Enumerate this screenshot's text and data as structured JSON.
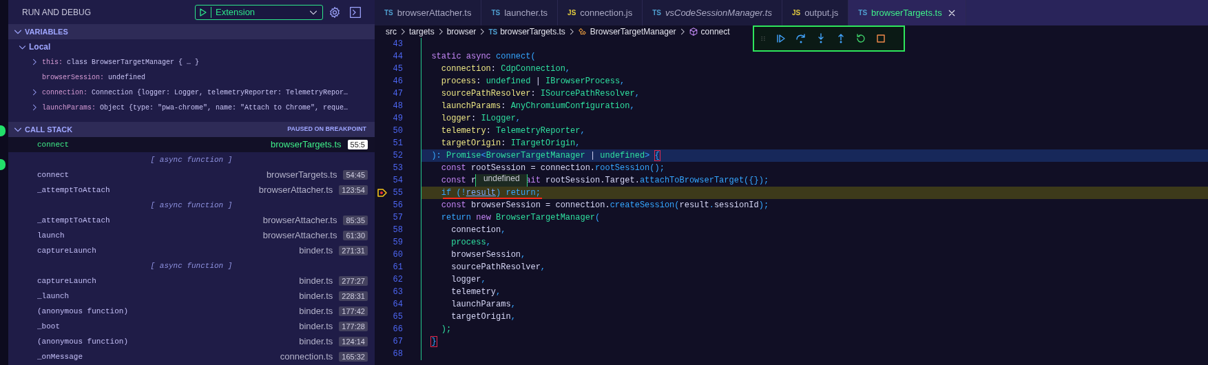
{
  "sidebar": {
    "title": "RUN AND DEBUG",
    "config": {
      "label": "Extension"
    },
    "variables": {
      "title": "VARIABLES",
      "expanded": true,
      "scopes": [
        {
          "label": "Local",
          "expanded": true,
          "children": [
            {
              "name": "this:",
              "value": "class BrowserTargetManager { … }",
              "expandable": true
            },
            {
              "name": "browserSession:",
              "value": "undefined",
              "expandable": false
            },
            {
              "name": "connection:",
              "value": "Connection {logger: Logger, telemetryReporter: TelemetryRepor…",
              "expandable": true
            },
            {
              "name": "launchParams:",
              "value": "Object {type: \"pwa-chrome\", name: \"Attach to Chrome\", reque…",
              "expandable": true
            }
          ]
        }
      ]
    },
    "call_stack": {
      "title": "CALL STACK",
      "status": "PAUSED ON BREAKPOINT",
      "expanded": true,
      "frames": [
        {
          "kind": "frame",
          "name": "connect",
          "file": "browserTargets.ts",
          "position": "55:5",
          "selected": true
        },
        {
          "kind": "async",
          "label": "[ async function ]"
        },
        {
          "kind": "frame",
          "name": "connect",
          "file": "browserTargets.ts",
          "position": "54:45",
          "selected": false
        },
        {
          "kind": "frame",
          "name": "_attemptToAttach",
          "file": "browserAttacher.ts",
          "position": "123:54",
          "selected": false
        },
        {
          "kind": "async",
          "label": "[ async function ]"
        },
        {
          "kind": "frame",
          "name": "_attemptToAttach",
          "file": "browserAttacher.ts",
          "position": "85:35",
          "selected": false
        },
        {
          "kind": "frame",
          "name": "launch",
          "file": "browserAttacher.ts",
          "position": "61:30",
          "selected": false
        },
        {
          "kind": "frame",
          "name": "captureLaunch",
          "file": "binder.ts",
          "position": "271:31",
          "selected": false
        },
        {
          "kind": "async",
          "label": "[ async function ]"
        },
        {
          "kind": "frame",
          "name": "captureLaunch",
          "file": "binder.ts",
          "position": "277:27",
          "selected": false
        },
        {
          "kind": "frame",
          "name": "_launch",
          "file": "binder.ts",
          "position": "228:31",
          "selected": false
        },
        {
          "kind": "frame",
          "name": "(anonymous function)",
          "file": "binder.ts",
          "position": "177:42",
          "selected": false
        },
        {
          "kind": "frame",
          "name": "_boot",
          "file": "binder.ts",
          "position": "177:28",
          "selected": false
        },
        {
          "kind": "frame",
          "name": "(anonymous function)",
          "file": "binder.ts",
          "position": "124:14",
          "selected": false
        },
        {
          "kind": "frame",
          "name": "_onMessage",
          "file": "connection.ts",
          "position": "165:32",
          "selected": false
        }
      ]
    }
  },
  "editor": {
    "tabs": [
      {
        "lang": "TS",
        "color": "#4f9fd0",
        "label": "browserAttacher.ts",
        "selected": false,
        "preview": false
      },
      {
        "lang": "TS",
        "color": "#4f9fd0",
        "label": "launcher.ts",
        "selected": false,
        "preview": false
      },
      {
        "lang": "JS",
        "color": "#e3cc3f",
        "label": "connection.js",
        "selected": false,
        "preview": false
      },
      {
        "lang": "TS",
        "color": "#4f9fd0",
        "label": "vsCodeSessionManager.ts",
        "selected": false,
        "preview": true
      },
      {
        "lang": "JS",
        "color": "#e3cc3f",
        "label": "output.js",
        "selected": false,
        "preview": false
      },
      {
        "lang": "TS",
        "color": "#4f9fd0",
        "label": "browserTargets.ts",
        "selected": true,
        "preview": false
      }
    ],
    "breadcrumbs": [
      {
        "kind": "folder",
        "label": "src"
      },
      {
        "kind": "folder",
        "label": "targets"
      },
      {
        "kind": "folder",
        "label": "browser"
      },
      {
        "kind": "file",
        "lang": "TS",
        "label": "browserTargets.ts"
      },
      {
        "kind": "class",
        "label": "BrowserTargetManager"
      },
      {
        "kind": "method",
        "label": "connect"
      }
    ],
    "lines": [
      {
        "n": "43"
      },
      {
        "n": "44",
        "tokens": [
          {
            "kind": "kw",
            "text": "  static async"
          },
          {
            "kind": "fn",
            "text": " connect("
          }
        ]
      },
      {
        "n": "45",
        "tokens": [
          {
            "kind": "param",
            "text": "    connection"
          },
          {
            "kind": "v",
            "text": ": "
          },
          {
            "kind": "type",
            "text": "CdpConnection"
          },
          {
            "kind": "p",
            "text": ","
          }
        ]
      },
      {
        "n": "46",
        "tokens": [
          {
            "kind": "param",
            "text": "    process"
          },
          {
            "kind": "v",
            "text": ": "
          },
          {
            "kind": "type",
            "text": "undefined"
          },
          {
            "kind": "v",
            "text": " | "
          },
          {
            "kind": "type",
            "text": "IBrowserProcess"
          },
          {
            "kind": "p",
            "text": ","
          }
        ]
      },
      {
        "n": "47",
        "tokens": [
          {
            "kind": "param",
            "text": "    sourcePathResolver"
          },
          {
            "kind": "v",
            "text": ": "
          },
          {
            "kind": "type",
            "text": "ISourcePathResolver"
          },
          {
            "kind": "p",
            "text": ","
          }
        ]
      },
      {
        "n": "48",
        "tokens": [
          {
            "kind": "param",
            "text": "    launchParams"
          },
          {
            "kind": "v",
            "text": ": "
          },
          {
            "kind": "type",
            "text": "AnyChromiumConfiguration"
          },
          {
            "kind": "p",
            "text": ","
          }
        ]
      },
      {
        "n": "49",
        "tokens": [
          {
            "kind": "param",
            "text": "    logger"
          },
          {
            "kind": "v",
            "text": ": "
          },
          {
            "kind": "type",
            "text": "ILogger"
          },
          {
            "kind": "p",
            "text": ","
          }
        ]
      },
      {
        "n": "50",
        "tokens": [
          {
            "kind": "param",
            "text": "    telemetry"
          },
          {
            "kind": "v",
            "text": ": "
          },
          {
            "kind": "type",
            "text": "TelemetryReporter"
          },
          {
            "kind": "p",
            "text": ","
          }
        ]
      },
      {
        "n": "51",
        "tokens": [
          {
            "kind": "param",
            "text": "    targetOrigin"
          },
          {
            "kind": "v",
            "text": ": "
          },
          {
            "kind": "type",
            "text": "ITargetOrigin"
          },
          {
            "kind": "p",
            "text": ","
          }
        ]
      },
      {
        "n": "52",
        "kind": "focus",
        "tokens": [
          {
            "kind": "p",
            "text": "  ): "
          },
          {
            "kind": "type",
            "text": "Promise"
          },
          {
            "kind": "p",
            "text": "<"
          },
          {
            "kind": "type",
            "text": "BrowserTargetManager"
          },
          {
            "kind": "v",
            "text": " | "
          },
          {
            "kind": "type",
            "text": "undefined"
          },
          {
            "kind": "p",
            "text": ">"
          },
          {
            "kind": "bm",
            "text": " {"
          }
        ]
      },
      {
        "n": "53",
        "tokens": [
          {
            "kind": "kw",
            "text": "    const"
          },
          {
            "kind": "v",
            "text": " rootSession = connection."
          },
          {
            "kind": "fn",
            "text": "rootSession"
          },
          {
            "kind": "p",
            "text": "();"
          }
        ]
      },
      {
        "n": "54",
        "tokens": [
          {
            "kind": "kw",
            "text": "    const"
          },
          {
            "kind": "v",
            "text": " r"
          },
          {
            "kind": "tooltip",
            "text": "undefined"
          },
          {
            "kind": "kw",
            "text": "ait"
          },
          {
            "kind": "v",
            "text": " rootSession.Target."
          },
          {
            "kind": "fn",
            "text": "attachToBrowserTarget"
          },
          {
            "kind": "p",
            "text": "({});"
          }
        ]
      },
      {
        "n": "55",
        "kind": "paused",
        "breakpoint": true,
        "squiggle": true,
        "tokens": [
          {
            "kind": "ctl",
            "text": "    if"
          },
          {
            "kind": "p",
            "text": " (!"
          },
          {
            "kind": "link",
            "text": "result"
          },
          {
            "kind": "p",
            "text": ")"
          },
          {
            "kind": "ctl",
            "text": " return"
          },
          {
            "kind": "p",
            "text": ";"
          }
        ]
      },
      {
        "n": "56",
        "tokens": [
          {
            "kind": "kw",
            "text": "    const"
          },
          {
            "kind": "v",
            "text": " browserSession = connection."
          },
          {
            "kind": "fn",
            "text": "createSession"
          },
          {
            "kind": "p",
            "text": "("
          },
          {
            "kind": "v",
            "text": "result"
          },
          {
            "kind": "p",
            "text": "."
          },
          {
            "kind": "v",
            "text": "sessionId"
          },
          {
            "kind": "p",
            "text": ");"
          }
        ]
      },
      {
        "n": "57",
        "tokens": [
          {
            "kind": "ctl",
            "text": "    return"
          },
          {
            "kind": "kw",
            "text": " new"
          },
          {
            "kind": "type",
            "text": " BrowserTargetManager"
          },
          {
            "kind": "p",
            "text": "("
          }
        ]
      },
      {
        "n": "58",
        "tokens": [
          {
            "kind": "v",
            "text": "      connection"
          },
          {
            "kind": "p",
            "text": ","
          }
        ]
      },
      {
        "n": "59",
        "tokens": [
          {
            "kind": "g",
            "text": "      process"
          },
          {
            "kind": "p",
            "text": ","
          }
        ]
      },
      {
        "n": "60",
        "tokens": [
          {
            "kind": "v",
            "text": "      browserSession"
          },
          {
            "kind": "p",
            "text": ","
          }
        ]
      },
      {
        "n": "61",
        "tokens": [
          {
            "kind": "v",
            "text": "      sourcePathResolver"
          },
          {
            "kind": "p",
            "text": ","
          }
        ]
      },
      {
        "n": "62",
        "tokens": [
          {
            "kind": "v",
            "text": "      logger"
          },
          {
            "kind": "p",
            "text": ","
          }
        ]
      },
      {
        "n": "63",
        "tokens": [
          {
            "kind": "v",
            "text": "      telemetry"
          },
          {
            "kind": "p",
            "text": ","
          }
        ]
      },
      {
        "n": "64",
        "tokens": [
          {
            "kind": "v",
            "text": "      launchParams"
          },
          {
            "kind": "p",
            "text": ","
          }
        ]
      },
      {
        "n": "65",
        "tokens": [
          {
            "kind": "v",
            "text": "      targetOrigin"
          },
          {
            "kind": "p",
            "text": ","
          }
        ]
      },
      {
        "n": "66",
        "tokens": [
          {
            "kind": "g",
            "text": "    );"
          }
        ]
      },
      {
        "n": "67",
        "tokens": [
          {
            "kind": "bm",
            "text": "  }"
          }
        ]
      },
      {
        "n": "68"
      }
    ]
  }
}
